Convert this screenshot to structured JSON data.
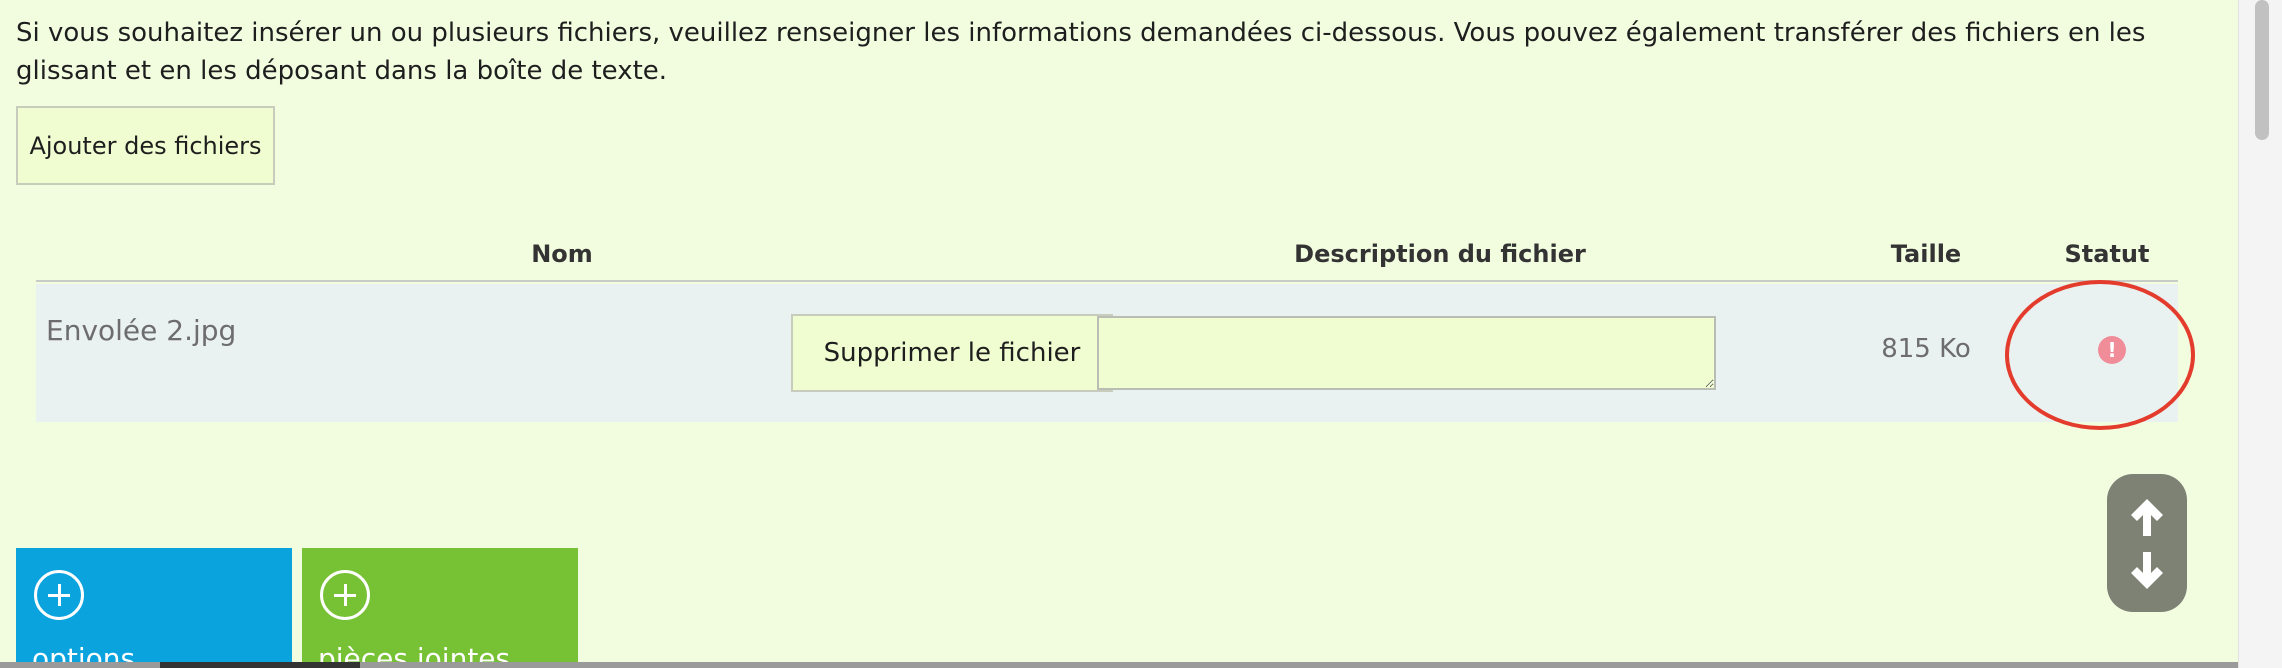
{
  "intro_text": "Si vous souhaitez insérer un ou plusieurs fichiers, veuillez renseigner les informations demandées ci-dessous. Vous pouvez également transférer des fichiers en les glissant et en les déposant dans la boîte de texte.",
  "add_files_button": "Ajouter des fichiers",
  "table": {
    "headers": {
      "name": "Nom",
      "description": "Description du fichier",
      "size": "Taille",
      "status": "Statut"
    },
    "rows": [
      {
        "name": "Envolée 2.jpg",
        "delete_label": "Supprimer le fichier",
        "description_value": "",
        "size": "815 Ko",
        "status_icon": "error-icon",
        "status_glyph": "!"
      }
    ]
  },
  "scroll_controls": {
    "up_icon": "arrow-up-icon",
    "down_icon": "arrow-down-icon",
    "color": "#7d8275"
  },
  "tiles": [
    {
      "label": "options",
      "icon": "plus-circle-icon",
      "color": "#0aa3de"
    },
    {
      "label": "pièces jointes",
      "icon": "plus-circle-icon",
      "color": "#77c135"
    }
  ],
  "colors": {
    "page_background": "#f2fde0",
    "button_background": "#f0fdd0",
    "row_background": "#eaf1f1",
    "status_error": "#f08d98",
    "highlight": "#e43c2c"
  }
}
